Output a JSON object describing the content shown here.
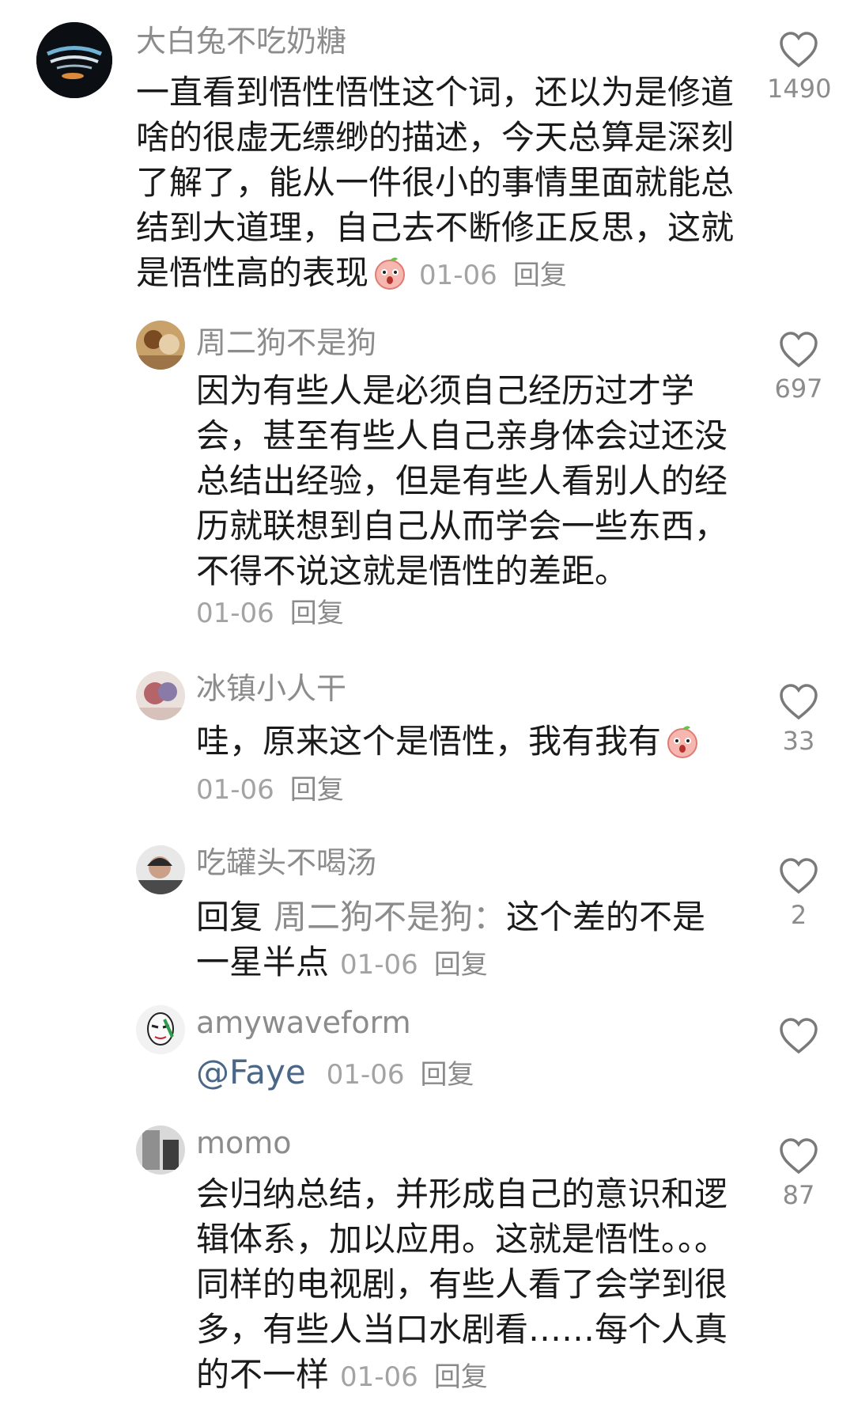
{
  "comments": [
    {
      "user": "大白兔不吃奶糖",
      "text": "一直看到悟性悟性这个词，还以为是修道啥的很虚无缥缈的描述，今天总算是深刻了解了，能从一件很小的事情里面就能总结到大道理，自己去不断修正反思，这就是悟性高的表现",
      "date": "01-06",
      "reply_label": "回复",
      "likes": "1490",
      "emoji": "surprised-peach-emoji"
    },
    {
      "user": "周二狗不是狗",
      "text": "因为有些人是必须自己经历过才学会，甚至有些人自己亲身体会过还没总结出经验，但是有些人看别人的经历就联想到自己从而学会一些东西，不得不说这就是悟性的差距。",
      "date": "01-06",
      "reply_label": "回复",
      "likes": "697"
    },
    {
      "user": "冰镇小人干",
      "text": "哇，原来这个是悟性，我有我有",
      "date": "01-06",
      "reply_label": "回复",
      "likes": "33",
      "emoji": "surprised-peach-emoji"
    },
    {
      "user": "吃罐头不喝汤",
      "reply_prefix": "回复",
      "reply_to": "周二狗不是狗：",
      "text_line1": "这个差的不是",
      "text_line2": "一星半点",
      "date": "01-06",
      "reply_label": "回复",
      "likes": "2"
    },
    {
      "user": "amywaveform",
      "mention": "@Faye",
      "date": "01-06",
      "reply_label": "回复",
      "likes": ""
    },
    {
      "user": "momo",
      "text": "会归纳总结，并形成自己的意识和逻辑体系，加以应用。这就是悟性。。。同样的电视剧，有些人看了会学到很多，有些人当口水剧看……每个人真的不一样",
      "date": "01-06",
      "reply_label": "回复",
      "likes": "87"
    }
  ],
  "colors": {
    "text": "#1a1a1a",
    "muted": "#8c8c8c",
    "link": "#4a6788"
  }
}
